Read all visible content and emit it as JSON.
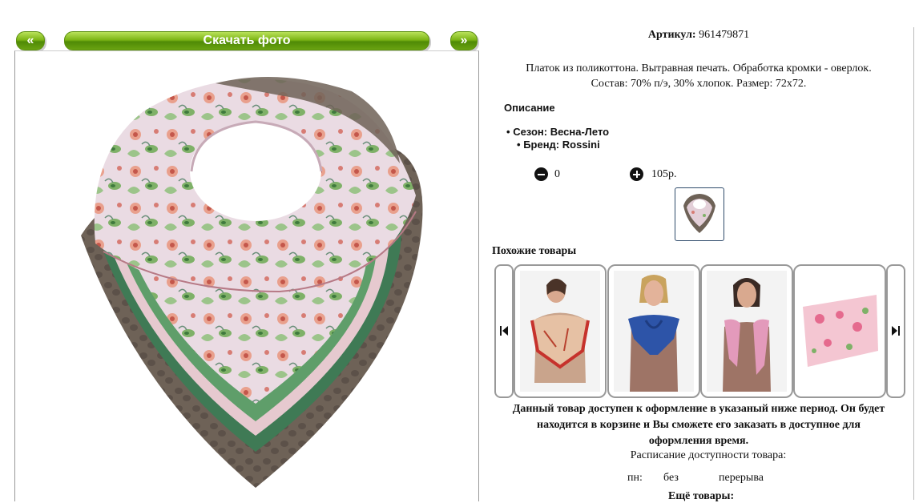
{
  "photo_nav": {
    "prev_label": "«",
    "download_label": "Скачать фото",
    "next_label": "»"
  },
  "product": {
    "article_label": "Артикул:",
    "article_value": "961479871",
    "description_line1": "Платок из поликоттона. Вытравная печать. Обработка кромки - оверлок.",
    "description_line2": "Состав: 70% п/э, 30% хлопок. Размер: 72х72.",
    "description_heading": "Описание",
    "attributes": [
      {
        "label": "Сезон:",
        "value": "Весна-Лето"
      },
      {
        "label": "Бренд:",
        "value": "Rossini"
      }
    ],
    "quantity": "0",
    "price": "105р."
  },
  "similar": {
    "heading": "Похожие товары",
    "items": [
      {
        "icon": "model-red-scarf"
      },
      {
        "icon": "model-blue-scarf"
      },
      {
        "icon": "model-pink-scarf"
      },
      {
        "icon": "floral-scarf"
      }
    ]
  },
  "availability": {
    "notice_line1": "Данный товар доступен к оформление в указаный ниже период. Он будет",
    "notice_line2": "находится в корзине и Вы сможете его заказать в доступное для",
    "notice_line3": "оформления время.",
    "schedule_label": "Расписание доступности товара:",
    "schedule_day": "пн:",
    "schedule_from": "без",
    "schedule_to": "перерыва",
    "more_label": "Ещё товары:"
  },
  "colors": {
    "accent_green": "#6aa311",
    "scarf_dark": "#6b5f55",
    "scarf_pink": "#e9d3dd"
  }
}
